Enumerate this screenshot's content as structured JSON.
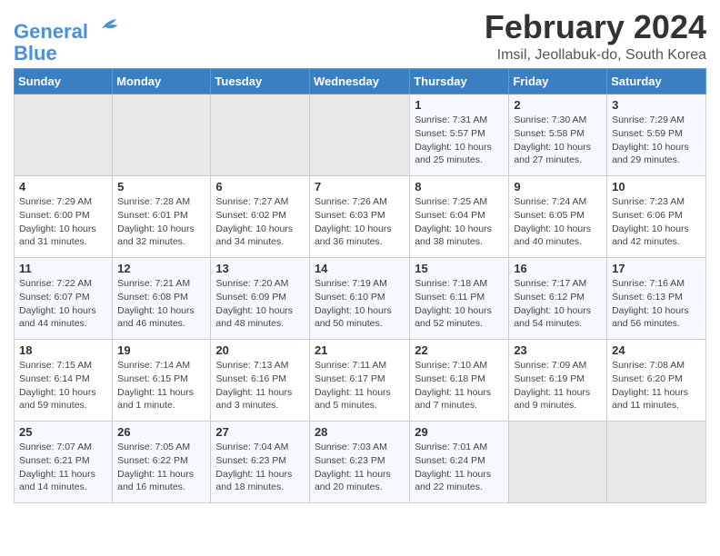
{
  "header": {
    "logo_line1": "General",
    "logo_line2": "Blue",
    "title": "February 2024",
    "subtitle": "Imsil, Jeollabuk-do, South Korea"
  },
  "weekdays": [
    "Sunday",
    "Monday",
    "Tuesday",
    "Wednesday",
    "Thursday",
    "Friday",
    "Saturday"
  ],
  "weeks": [
    [
      {
        "day": "",
        "empty": true
      },
      {
        "day": "",
        "empty": true
      },
      {
        "day": "",
        "empty": true
      },
      {
        "day": "",
        "empty": true
      },
      {
        "day": "1",
        "sunrise": "7:31 AM",
        "sunset": "5:57 PM",
        "daylight": "10 hours and 25 minutes."
      },
      {
        "day": "2",
        "sunrise": "7:30 AM",
        "sunset": "5:58 PM",
        "daylight": "10 hours and 27 minutes."
      },
      {
        "day": "3",
        "sunrise": "7:29 AM",
        "sunset": "5:59 PM",
        "daylight": "10 hours and 29 minutes."
      }
    ],
    [
      {
        "day": "4",
        "sunrise": "7:29 AM",
        "sunset": "6:00 PM",
        "daylight": "10 hours and 31 minutes."
      },
      {
        "day": "5",
        "sunrise": "7:28 AM",
        "sunset": "6:01 PM",
        "daylight": "10 hours and 32 minutes."
      },
      {
        "day": "6",
        "sunrise": "7:27 AM",
        "sunset": "6:02 PM",
        "daylight": "10 hours and 34 minutes."
      },
      {
        "day": "7",
        "sunrise": "7:26 AM",
        "sunset": "6:03 PM",
        "daylight": "10 hours and 36 minutes."
      },
      {
        "day": "8",
        "sunrise": "7:25 AM",
        "sunset": "6:04 PM",
        "daylight": "10 hours and 38 minutes."
      },
      {
        "day": "9",
        "sunrise": "7:24 AM",
        "sunset": "6:05 PM",
        "daylight": "10 hours and 40 minutes."
      },
      {
        "day": "10",
        "sunrise": "7:23 AM",
        "sunset": "6:06 PM",
        "daylight": "10 hours and 42 minutes."
      }
    ],
    [
      {
        "day": "11",
        "sunrise": "7:22 AM",
        "sunset": "6:07 PM",
        "daylight": "10 hours and 44 minutes."
      },
      {
        "day": "12",
        "sunrise": "7:21 AM",
        "sunset": "6:08 PM",
        "daylight": "10 hours and 46 minutes."
      },
      {
        "day": "13",
        "sunrise": "7:20 AM",
        "sunset": "6:09 PM",
        "daylight": "10 hours and 48 minutes."
      },
      {
        "day": "14",
        "sunrise": "7:19 AM",
        "sunset": "6:10 PM",
        "daylight": "10 hours and 50 minutes."
      },
      {
        "day": "15",
        "sunrise": "7:18 AM",
        "sunset": "6:11 PM",
        "daylight": "10 hours and 52 minutes."
      },
      {
        "day": "16",
        "sunrise": "7:17 AM",
        "sunset": "6:12 PM",
        "daylight": "10 hours and 54 minutes."
      },
      {
        "day": "17",
        "sunrise": "7:16 AM",
        "sunset": "6:13 PM",
        "daylight": "10 hours and 56 minutes."
      }
    ],
    [
      {
        "day": "18",
        "sunrise": "7:15 AM",
        "sunset": "6:14 PM",
        "daylight": "10 hours and 59 minutes."
      },
      {
        "day": "19",
        "sunrise": "7:14 AM",
        "sunset": "6:15 PM",
        "daylight": "11 hours and 1 minute."
      },
      {
        "day": "20",
        "sunrise": "7:13 AM",
        "sunset": "6:16 PM",
        "daylight": "11 hours and 3 minutes."
      },
      {
        "day": "21",
        "sunrise": "7:11 AM",
        "sunset": "6:17 PM",
        "daylight": "11 hours and 5 minutes."
      },
      {
        "day": "22",
        "sunrise": "7:10 AM",
        "sunset": "6:18 PM",
        "daylight": "11 hours and 7 minutes."
      },
      {
        "day": "23",
        "sunrise": "7:09 AM",
        "sunset": "6:19 PM",
        "daylight": "11 hours and 9 minutes."
      },
      {
        "day": "24",
        "sunrise": "7:08 AM",
        "sunset": "6:20 PM",
        "daylight": "11 hours and 11 minutes."
      }
    ],
    [
      {
        "day": "25",
        "sunrise": "7:07 AM",
        "sunset": "6:21 PM",
        "daylight": "11 hours and 14 minutes."
      },
      {
        "day": "26",
        "sunrise": "7:05 AM",
        "sunset": "6:22 PM",
        "daylight": "11 hours and 16 minutes."
      },
      {
        "day": "27",
        "sunrise": "7:04 AM",
        "sunset": "6:23 PM",
        "daylight": "11 hours and 18 minutes."
      },
      {
        "day": "28",
        "sunrise": "7:03 AM",
        "sunset": "6:23 PM",
        "daylight": "11 hours and 20 minutes."
      },
      {
        "day": "29",
        "sunrise": "7:01 AM",
        "sunset": "6:24 PM",
        "daylight": "11 hours and 22 minutes."
      },
      {
        "day": "",
        "empty": true
      },
      {
        "day": "",
        "empty": true
      }
    ]
  ]
}
